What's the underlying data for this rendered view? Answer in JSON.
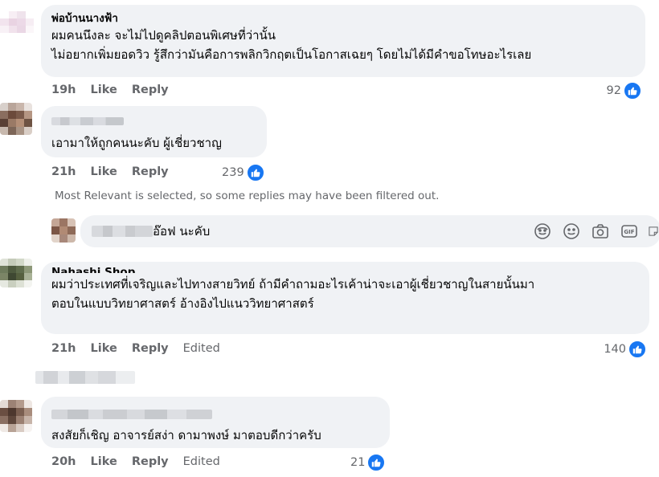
{
  "comments": [
    {
      "author": "พ่อบ้านนางฟ้า",
      "line1": "ผมคนนึงละ จะไม่ไปดูคลิปตอนพิเศษที่ว่านั้น",
      "line2": "ไม่อยากเพิ่มยอดวิว รู้สึกว่ามันคือการพลิกวิกฤตเป็นโอกาสเฉยๆ โดยไม่ได้มีคำขอโทษอะไรเลย",
      "time": "19h",
      "like": "Like",
      "reply": "Reply",
      "count": "92"
    },
    {
      "author": "",
      "line1": "เอามาให้ถูกคนนะคับ ผู้เชี่ยวชาญ",
      "time": "21h",
      "like": "Like",
      "reply": "Reply",
      "count": "239"
    },
    {
      "author": "Nahashi Shop",
      "line1": "ผมว่าประเทศที่เจริญและไปทางสายวิทย์ ถ้ามีคำถามอะไรเค้าน่าจะเอาผู้เชี่ยวชาญในสายนั้นมา",
      "line2": "ตอบในแบบวิทยาศาสตร์ อ้างอิงไปแนววิทยาศาสตร์",
      "time": "21h",
      "like": "Like",
      "reply": "Reply",
      "edited": "Edited",
      "count": "140"
    },
    {
      "author": "",
      "line1": "สงสัยก็เชิญ อาจารย์สง่า ดามาพงษ์ มาตอบดีกว่าครับ",
      "time": "20h",
      "like": "Like",
      "reply": "Reply",
      "edited": "Edited",
      "count": "21"
    }
  ],
  "filter_note": "Most Relevant is selected, so some replies may have been filtered out.",
  "composer": {
    "text": "อ๊อฟ นะคับ"
  },
  "icons": {
    "like": "thumbs-up-icon",
    "avatar_sticker": "avatar-sticker-icon",
    "emoji": "emoji-icon",
    "camera": "camera-icon",
    "gif": "gif-icon",
    "sticker": "sticker-icon"
  },
  "colors": {
    "accent": "#1877f2",
    "bubble": "#f0f2f5",
    "meta": "#65676b"
  }
}
